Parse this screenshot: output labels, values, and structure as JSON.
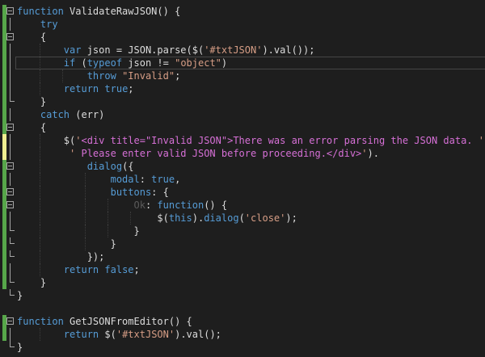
{
  "editor": {
    "colors": {
      "background": "#1e1e1e",
      "keyword": "#569cd6",
      "string": "#d69d85",
      "html_string": "#d670d6",
      "plain": "#dcdcdc",
      "saved_change": "#57a64a",
      "unsaved_change": "#efef91"
    },
    "lines": [
      {
        "t": [
          [
            "kw",
            "function"
          ],
          [
            "id",
            " ValidateRawJSON() {"
          ]
        ]
      },
      {
        "t": [
          [
            "id",
            "    "
          ],
          [
            "kw",
            "try"
          ]
        ]
      },
      {
        "t": [
          [
            "id",
            "    {"
          ]
        ]
      },
      {
        "t": [
          [
            "id",
            "        "
          ],
          [
            "kw",
            "var"
          ],
          [
            "id",
            " json = JSON.parse($("
          ],
          [
            "str",
            "'#txtJSON'"
          ],
          [
            "id",
            ").val());"
          ]
        ]
      },
      {
        "t": [
          [
            "id",
            "        "
          ],
          [
            "kw",
            "if"
          ],
          [
            "id",
            " ("
          ],
          [
            "kw",
            "typeof"
          ],
          [
            "id",
            " json != "
          ],
          [
            "str",
            "\"object\""
          ],
          [
            "id",
            ")"
          ]
        ]
      },
      {
        "t": [
          [
            "id",
            "            "
          ],
          [
            "kw",
            "throw"
          ],
          [
            "id",
            " "
          ],
          [
            "str",
            "\"Invalid\""
          ],
          [
            "id",
            ";"
          ]
        ]
      },
      {
        "t": [
          [
            "id",
            "        "
          ],
          [
            "kw",
            "return"
          ],
          [
            "id",
            " "
          ],
          [
            "kw",
            "true"
          ],
          [
            "id",
            ";"
          ]
        ]
      },
      {
        "t": [
          [
            "id",
            "    }"
          ]
        ]
      },
      {
        "t": [
          [
            "id",
            "    "
          ],
          [
            "kw",
            "catch"
          ],
          [
            "id",
            " (err)"
          ]
        ]
      },
      {
        "t": [
          [
            "id",
            "    {"
          ]
        ]
      },
      {
        "t": [
          [
            "id",
            "        $("
          ],
          [
            "str",
            "'"
          ],
          [
            "strm",
            "<div title=\"Invalid JSON\">There was an error parsing the JSON data. "
          ],
          [
            "str",
            "' +"
          ]
        ]
      },
      {
        "t": [
          [
            "id",
            "         "
          ],
          [
            "str",
            "' "
          ],
          [
            "strm",
            "Please enter valid JSON before proceeding.</div>"
          ],
          [
            "str",
            "'"
          ],
          [
            "id",
            ")."
          ]
        ]
      },
      {
        "t": [
          [
            "id",
            "            "
          ],
          [
            "kw",
            "dialog"
          ],
          [
            "id",
            "({"
          ]
        ]
      },
      {
        "t": [
          [
            "id",
            "                "
          ],
          [
            "kw",
            "modal"
          ],
          [
            "id",
            ": "
          ],
          [
            "kw",
            "true"
          ],
          [
            "id",
            ","
          ]
        ]
      },
      {
        "t": [
          [
            "id",
            "                "
          ],
          [
            "kw",
            "buttons"
          ],
          [
            "id",
            ": {"
          ]
        ]
      },
      {
        "t": [
          [
            "id",
            "                    "
          ],
          [
            "muted",
            "Ok"
          ],
          [
            "id",
            ": "
          ],
          [
            "kw",
            "function"
          ],
          [
            "id",
            "() {"
          ]
        ]
      },
      {
        "t": [
          [
            "id",
            "                        $("
          ],
          [
            "kw",
            "this"
          ],
          [
            "id",
            ")."
          ],
          [
            "kw",
            "dialog"
          ],
          [
            "id",
            "("
          ],
          [
            "str",
            "'close'"
          ],
          [
            "id",
            ");"
          ]
        ]
      },
      {
        "t": [
          [
            "id",
            "                    }"
          ]
        ]
      },
      {
        "t": [
          [
            "id",
            "                }"
          ]
        ]
      },
      {
        "t": [
          [
            "id",
            "            });"
          ]
        ]
      },
      {
        "t": [
          [
            "id",
            "        "
          ],
          [
            "kw",
            "return"
          ],
          [
            "id",
            " "
          ],
          [
            "kw",
            "false"
          ],
          [
            "id",
            ";"
          ]
        ]
      },
      {
        "t": [
          [
            "id",
            "    }"
          ]
        ]
      },
      {
        "t": [
          [
            "id",
            "}"
          ]
        ]
      },
      {
        "t": []
      },
      {
        "t": [
          [
            "kw",
            "function"
          ],
          [
            "id",
            " GetJSONFromEditor() {"
          ]
        ]
      },
      {
        "t": [
          [
            "id",
            "        "
          ],
          [
            "kw",
            "return"
          ],
          [
            "id",
            " $("
          ],
          [
            "str",
            "'#txtJSON'"
          ],
          [
            "id",
            ").val();"
          ]
        ]
      },
      {
        "t": [
          [
            "id",
            "}"
          ]
        ]
      }
    ]
  }
}
